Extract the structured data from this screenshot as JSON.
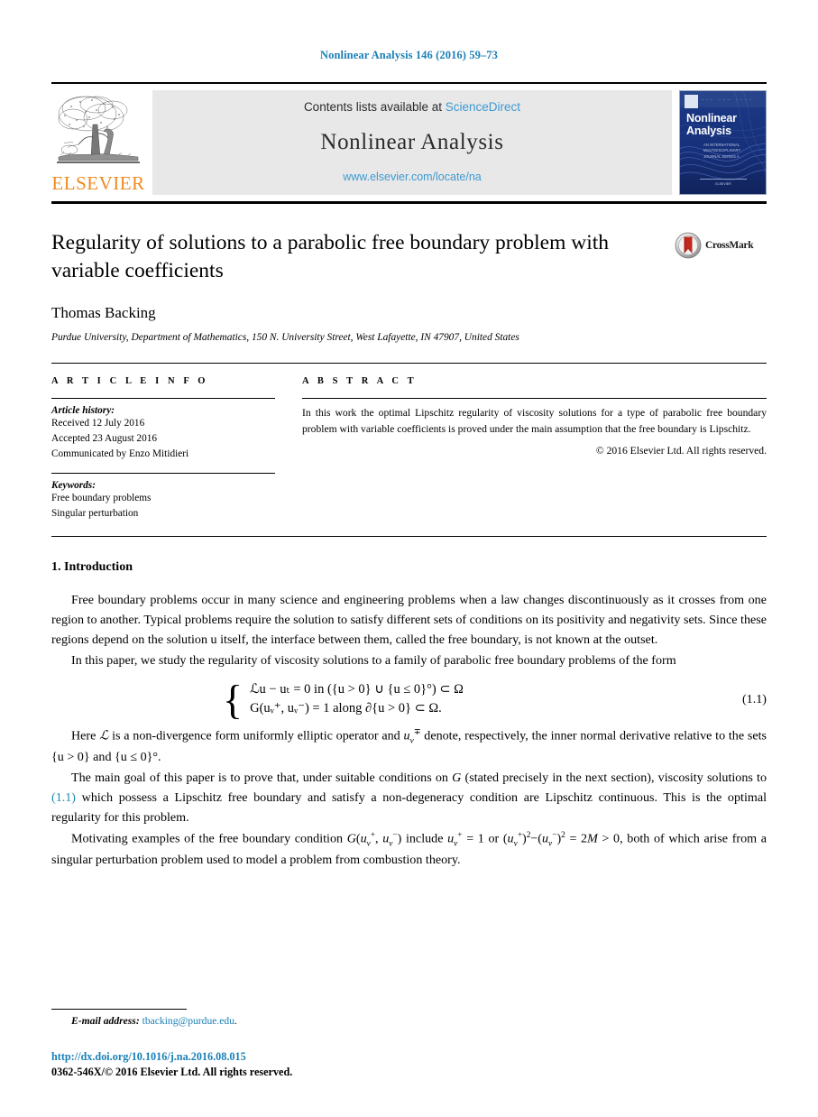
{
  "running_head": "Nonlinear Analysis 146 (2016) 59–73",
  "masthead": {
    "contents_prefix": "Contents lists available at ",
    "sciencedirect": "ScienceDirect",
    "journal_name": "Nonlinear Analysis",
    "journal_url": "www.elsevier.com/locate/na",
    "publisher_word": "ELSEVIER",
    "cover": {
      "title_line1": "Nonlinear",
      "title_line2": "Analysis",
      "subtitle": "AN INTERNATIONAL\nMULTIDISCIPLINARY\nJOURNAL SERIES A:\nTHEORY, METHODS\n& APPLICATIONS",
      "footer": "ELSEVIER"
    }
  },
  "article": {
    "title": "Regularity of solutions to a parabolic free boundary problem with variable coefficients",
    "crossmark_label": "CrossMark",
    "author": "Thomas Backing",
    "affiliation": "Purdue University, Department of Mathematics, 150 N. University Street, West Lafayette, IN 47907, United States"
  },
  "info": {
    "heading": "A R T I C L E   I N F O",
    "history_heading": "Article history:",
    "history": [
      "Received 12 July 2016",
      "Accepted 23 August 2016",
      "Communicated by Enzo Mitidieri"
    ],
    "keywords_heading": "Keywords:",
    "keywords": [
      "Free boundary problems",
      "Singular perturbation"
    ]
  },
  "abstract": {
    "heading": "A B S T R A C T",
    "text": "In this work the optimal Lipschitz regularity of viscosity solutions for a type of parabolic free boundary problem with variable coefficients is proved under the main assumption that the free boundary is Lipschitz.",
    "copyright": "© 2016 Elsevier Ltd. All rights reserved."
  },
  "body": {
    "section_heading": "1. Introduction",
    "par1": "Free boundary problems occur in many science and engineering problems when a law changes discontinuously as it crosses from one region to another. Typical problems require the solution to satisfy different sets of conditions on its positivity and negativity sets. Since these regions depend on the solution u itself, the interface between them, called the free boundary, is not known at the outset.",
    "par2": "In this paper, we study the regularity of viscosity solutions to a family of parabolic free boundary problems of the form",
    "equation": {
      "line1": "ℒu − uₜ = 0   in ({u > 0} ∪ {u ≤ 0}°) ⊂ Ω",
      "line2": "G(uᵥ⁺, uᵥ⁻) = 1   along ∂{u > 0} ⊂ Ω.",
      "number": "(1.1)"
    },
    "par3_a": "Here ",
    "par3_b": " is a non-divergence form uniformly elliptic operator and ",
    "par3_c": " denote, respectively, the inner normal derivative relative to the sets {u > 0} and {u ≤ 0}°.",
    "par4_a": "The main goal of this paper is to prove that, under suitable conditions on ",
    "par4_b": " (stated precisely in the next section), viscosity solutions to ",
    "par4_link": "(1.1)",
    "par4_c": " which possess a Lipschitz free boundary and satisfy a non-degeneracy condition are Lipschitz continuous. This is the optimal regularity for this problem.",
    "par5_a": "Motivating examples of the free boundary condition ",
    "par5_b": " include ",
    "par5_c": ", both of which arise from a singular perturbation problem used to model a problem from combustion theory."
  },
  "footer": {
    "email_label": "E-mail address:",
    "email": "tbacking@purdue.edu",
    "email_period": ".",
    "doi": "http://dx.doi.org/10.1016/j.na.2016.08.015",
    "issn": "0362-546X/© 2016 Elsevier Ltd. All rights reserved."
  },
  "colors": {
    "link_blue": "#1a7fb5",
    "sciencedirect_blue": "#3d9ad1",
    "elsevier_orange": "#ed8b20",
    "crossmark_red": "#c1281e",
    "cover_blue": "#18357a"
  }
}
